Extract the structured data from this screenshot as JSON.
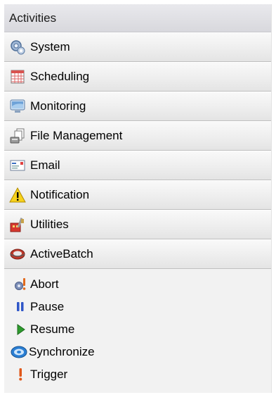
{
  "panel": {
    "title": "Activities"
  },
  "categories": [
    {
      "label": "System",
      "icon": "system-icon"
    },
    {
      "label": "Scheduling",
      "icon": "calendar-icon"
    },
    {
      "label": "Monitoring",
      "icon": "monitor-icon"
    },
    {
      "label": "File Management",
      "icon": "file-management-icon"
    },
    {
      "label": "Email",
      "icon": "email-icon"
    },
    {
      "label": "Notification",
      "icon": "warning-icon"
    },
    {
      "label": "Utilities",
      "icon": "utilities-icon"
    },
    {
      "label": "ActiveBatch",
      "icon": "activebatch-icon"
    }
  ],
  "actions": [
    {
      "label": "Abort",
      "icon": "abort-icon"
    },
    {
      "label": "Pause",
      "icon": "pause-icon"
    },
    {
      "label": "Resume",
      "icon": "resume-icon"
    },
    {
      "label": "Synchronize",
      "icon": "synchronize-icon"
    },
    {
      "label": "Trigger",
      "icon": "trigger-icon"
    }
  ]
}
